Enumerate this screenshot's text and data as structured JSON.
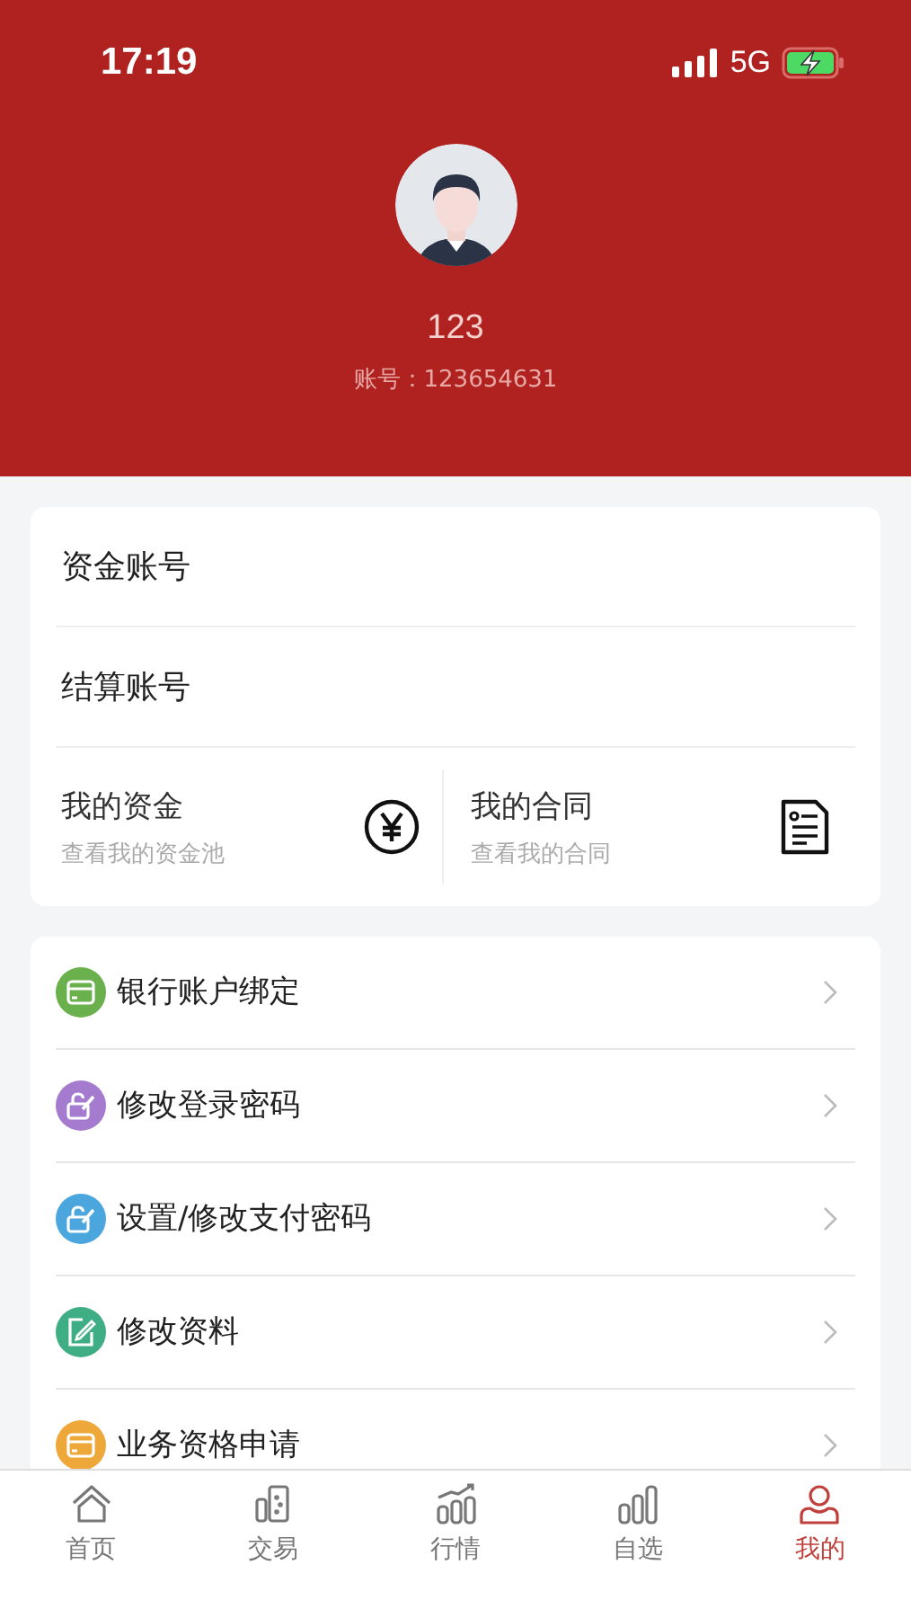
{
  "status_bar": {
    "time": "17:19",
    "network": "5G"
  },
  "profile": {
    "name": "123",
    "account": "账号：123654631"
  },
  "account_rows": [
    "资金账号",
    "结算账号"
  ],
  "shortcuts": [
    {
      "title": "我的资金",
      "subtitle": "查看我的资金池",
      "kind": "yen"
    },
    {
      "title": "我的合同",
      "subtitle": "查看我的合同",
      "kind": "document"
    }
  ],
  "menu": [
    {
      "label": "银行账户绑定",
      "kind": "card",
      "color": "#6ab04c"
    },
    {
      "label": "修改登录密码",
      "kind": "lock-edit",
      "color": "#a57bd0"
    },
    {
      "label": "设置/修改支付密码",
      "kind": "lock-edit",
      "color": "#4aa6dc"
    },
    {
      "label": "修改资料",
      "kind": "edit",
      "color": "#3fae84"
    },
    {
      "label": "业务资格申请",
      "kind": "card",
      "color": "#eea83a"
    }
  ],
  "tabs": [
    {
      "label": "首页",
      "kind": "home",
      "selected": false
    },
    {
      "label": "交易",
      "kind": "trade",
      "selected": false
    },
    {
      "label": "行情",
      "kind": "market",
      "selected": false
    },
    {
      "label": "自选",
      "kind": "watch",
      "selected": false
    },
    {
      "label": "我的",
      "kind": "user",
      "selected": true
    }
  ]
}
